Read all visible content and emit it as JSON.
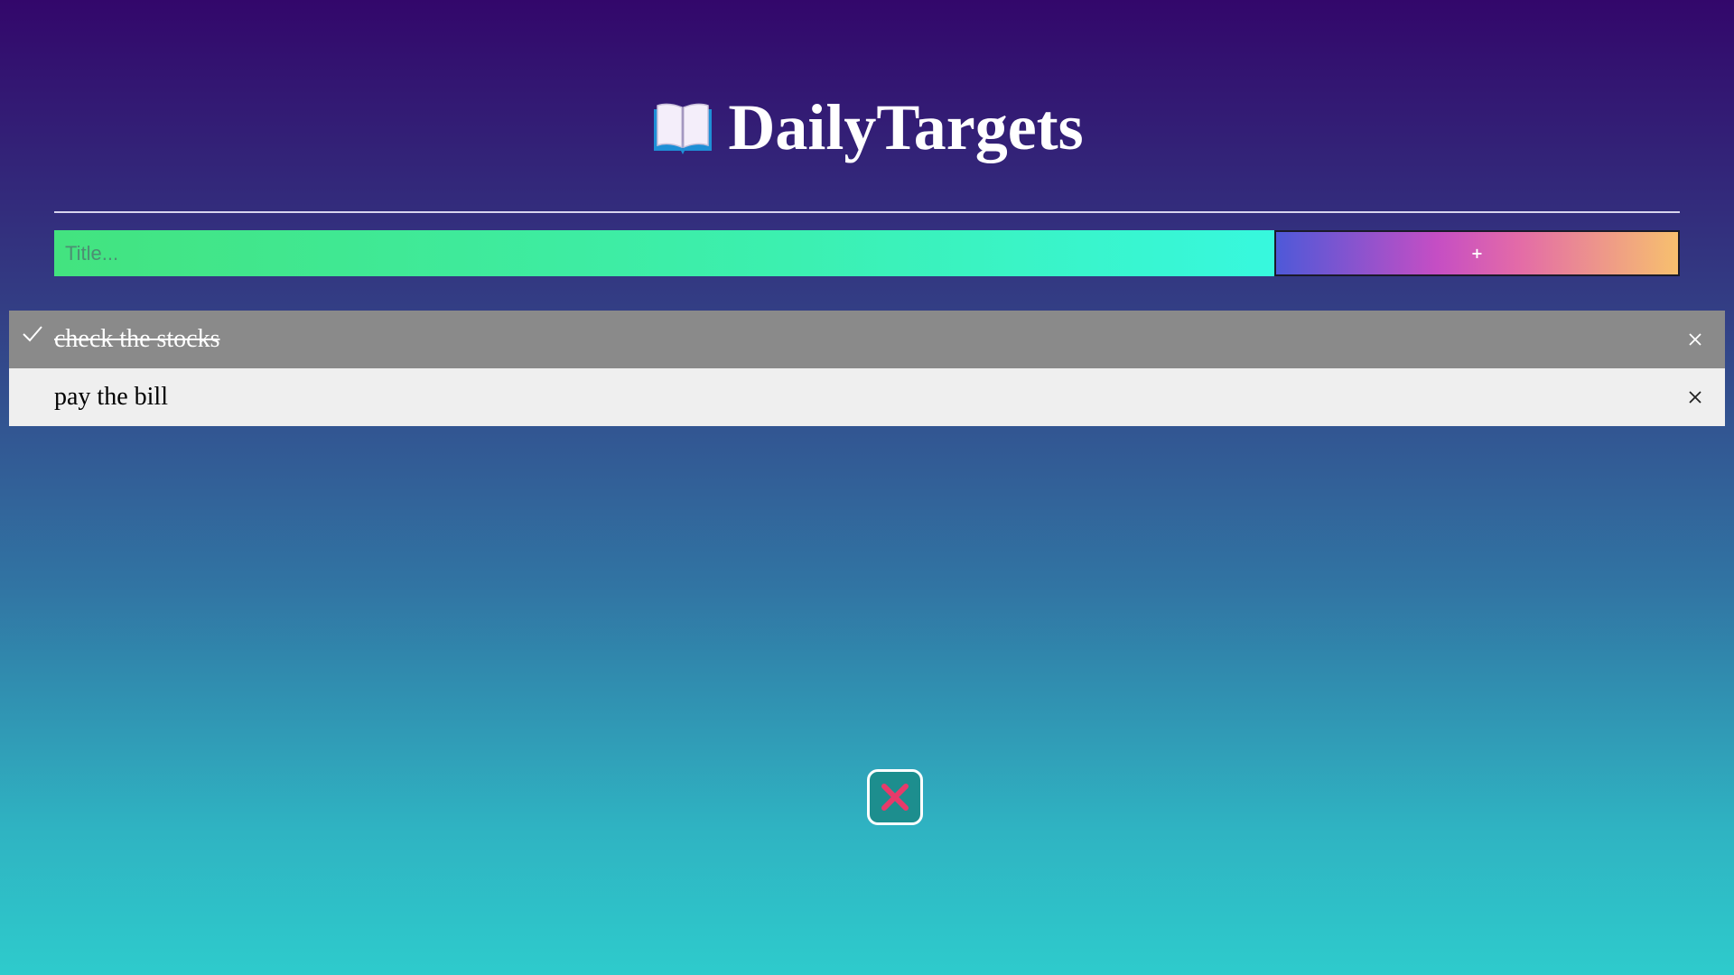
{
  "app": {
    "title": "DailyTargets",
    "icon": "open-book-icon"
  },
  "form": {
    "title_placeholder": "Title...",
    "title_value": "",
    "add_label": "+"
  },
  "todos": [
    {
      "text": "check the stocks",
      "completed": true,
      "check_icon": "check-icon",
      "delete_icon": "close-icon"
    },
    {
      "text": "pay the bill",
      "completed": false,
      "delete_icon": "close-icon"
    }
  ],
  "clear_button": {
    "icon": "red-x-icon"
  },
  "colors": {
    "background_top": "#33076b",
    "background_bottom": "#2ecbcc",
    "input_gradient_start": "#43e37f",
    "input_gradient_end": "#37f8de",
    "add_gradient_start": "#4e59d8",
    "add_gradient_mid": "#c54ec4",
    "add_gradient_end": "#f7c06e",
    "completed_row": "#8a8a8a",
    "pending_row": "#efefef",
    "clear_button_bg": "#1d8e8e",
    "clear_x": "#e83a6a"
  }
}
